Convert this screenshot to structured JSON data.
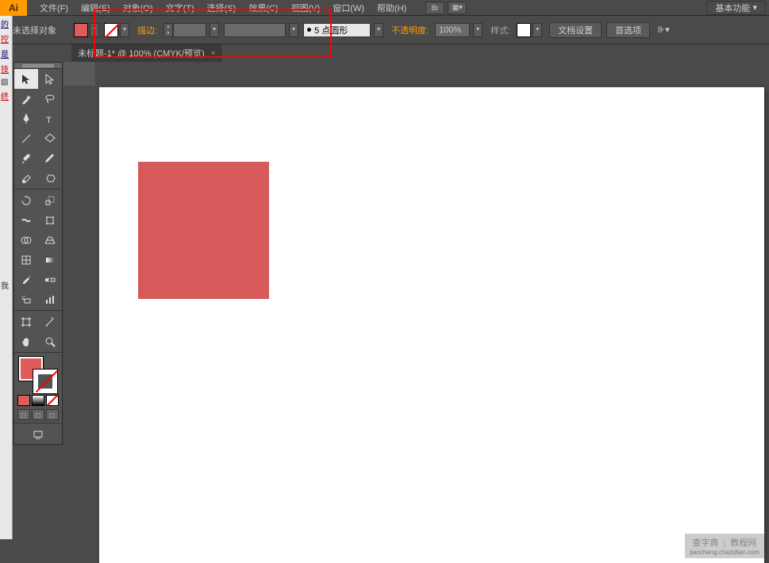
{
  "logo": "Ai",
  "menu": {
    "file": "文件(F)",
    "edit": "编辑(E)",
    "object": "对象(O)",
    "type": "文字(T)",
    "select": "选择(S)",
    "effect": "效果(C)",
    "view": "视图(V)",
    "window": "窗口(W)",
    "help": "帮助(H)"
  },
  "bridge_icon": "Br",
  "workspace": "基本功能",
  "control": {
    "no_selection": "未选择对象",
    "stroke_label": "描边:",
    "brush_value": "5 点圆形",
    "opacity_label": "不透明度:",
    "opacity_value": "100%",
    "style_label": "样式:",
    "doc_setup": "文档设置",
    "prefs": "首选项"
  },
  "tab": {
    "title": "未标题-1* @ 100% (CMYK/预览)",
    "close": "×"
  },
  "watermark": {
    "a": "查字典",
    "b": "教程网",
    "c": "jiaocheng.chazidian.com"
  },
  "colors": {
    "fill": "#e05b5b"
  }
}
